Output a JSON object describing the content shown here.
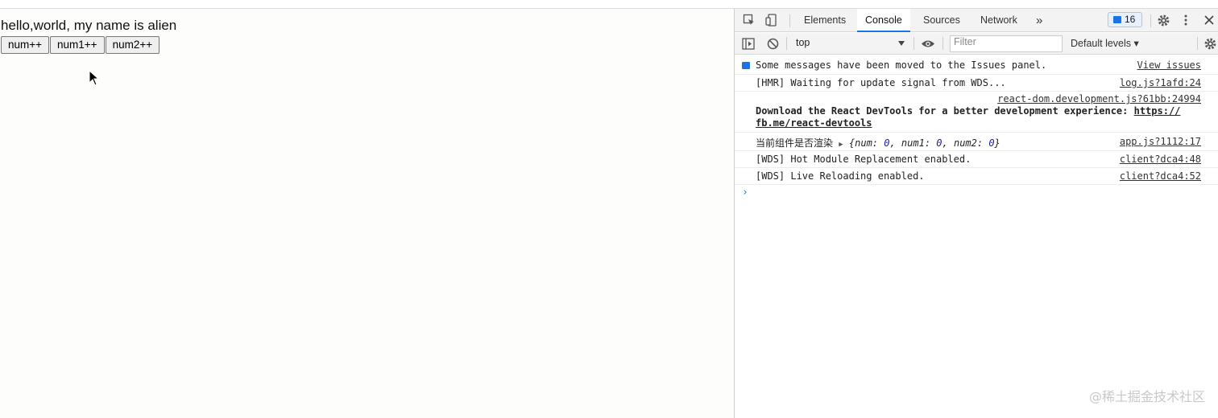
{
  "page": {
    "greeting": "hello,world, my name is alien",
    "buttons": [
      "num++",
      "num1++",
      "num2++"
    ]
  },
  "devtools": {
    "tabs": [
      "Elements",
      "Console",
      "Sources",
      "Network"
    ],
    "more_tabs_icon": "»",
    "issues_count": "16",
    "toolbar": {
      "context": "top",
      "filter_placeholder": "Filter",
      "levels": "Default levels ▾"
    },
    "messages": [
      {
        "text": "Some messages have been moved to the Issues panel.",
        "source": "View issues"
      },
      {
        "text": "[HMR] Waiting for update signal from WDS...",
        "source": "log.js?1afd:24"
      },
      {
        "source": "react-dom.development.js?61bb:24994",
        "line1": "Download the React DevTools for a better development experience: ",
        "link1": "https://",
        "link2": "fb.me/react-devtools"
      },
      {
        "label": "当前组件是否渲染 ",
        "obj_prefix": "{num: ",
        "v0": "0",
        "sep1": ", num1: ",
        "v1": "0",
        "sep2": ", num2: ",
        "v2": "0",
        "obj_suffix": "}",
        "source": "app.js?1112:17"
      },
      {
        "text": "[WDS] Hot Module Replacement enabled.",
        "source": "client?dca4:48"
      },
      {
        "text": "[WDS] Live Reloading enabled.",
        "source": "client?dca4:52"
      }
    ],
    "prompt": "›"
  },
  "watermark": "@稀土掘金技术社区",
  "colors": {
    "accent": "#1a73e8",
    "number": "#1a1aa6"
  }
}
